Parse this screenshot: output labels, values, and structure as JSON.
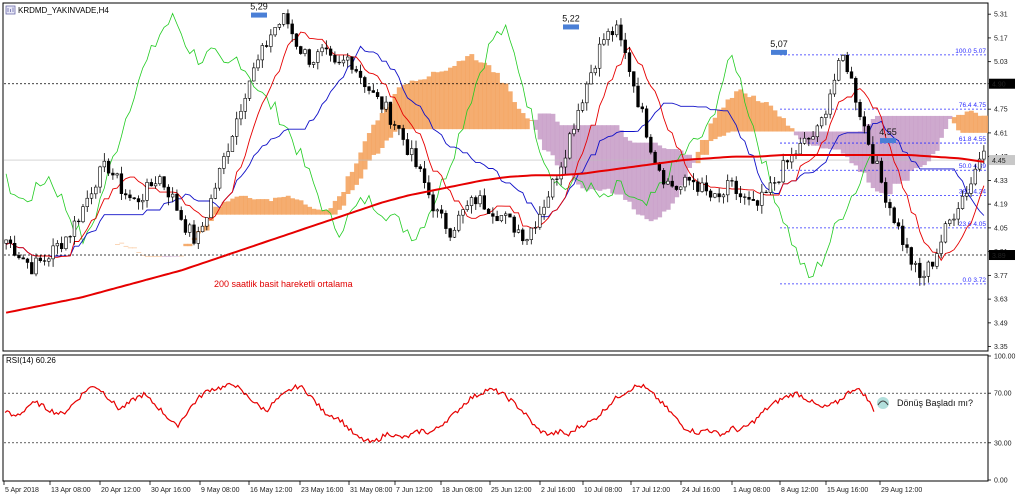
{
  "chart_data": [
    {
      "type": "candlestick",
      "title": "KRDMD_YAKINVADE,H4",
      "ylim": [
        3.33,
        5.37
      ],
      "y_ticks": [
        "5.31",
        "5.17",
        "5.03",
        "4.90",
        "4.75",
        "4.61",
        "4.47",
        "4.33",
        "4.19",
        "4.05",
        "3.91",
        "3.77",
        "3.63",
        "3.49",
        "3.35"
      ],
      "x_ticks": [
        "5 Apr 2018",
        "13 Apr 08:00",
        "20 Apr 12:00",
        "30 Apr 16:00",
        "9 May 08:00",
        "16 May 12:00",
        "23 May 16:00",
        "31 May 08:00",
        "7 Jun 12:00",
        "18 Jun 08:00",
        "25 Jun 12:00",
        "2 Jul 16:00",
        "10 Jul 08:00",
        "17 Jul 12:00",
        "24 Jul 16:00",
        "1 Aug 08:00",
        "8 Aug 12:00",
        "15 Aug 16:00",
        "29 Aug 12:00"
      ],
      "price_series": [
        3.98,
        3.9,
        3.82,
        3.86,
        3.94,
        4.02,
        4.16,
        4.33,
        4.42,
        4.29,
        4.2,
        4.26,
        4.36,
        4.24,
        4.08,
        3.96,
        4.18,
        4.42,
        4.66,
        4.9,
        5.05,
        5.22,
        5.29,
        5.12,
        5.04,
        5.08,
        4.98,
        5.06,
        4.94,
        4.82,
        4.74,
        4.62,
        4.46,
        4.3,
        4.12,
        4.04,
        4.14,
        4.22,
        4.18,
        4.12,
        4.06,
        4.0,
        4.14,
        4.3,
        4.5,
        4.74,
        4.96,
        5.16,
        5.22,
        5.02,
        4.74,
        4.48,
        4.32,
        4.28,
        4.34,
        4.26,
        4.2,
        4.3,
        4.22,
        4.16,
        4.26,
        4.38,
        4.48,
        4.56,
        4.62,
        4.88,
        5.07,
        4.8,
        4.54,
        4.3,
        4.1,
        3.9,
        3.74,
        3.86,
        4.04,
        4.2,
        4.32,
        4.55
      ],
      "ma200": [
        3.55,
        3.58,
        3.61,
        3.64,
        3.68,
        3.72,
        3.76,
        3.8,
        3.85,
        3.9,
        3.95,
        4.0,
        4.05,
        4.1,
        4.15,
        4.2,
        4.24,
        4.27,
        4.3,
        4.33,
        4.35,
        4.36,
        4.36,
        4.37,
        4.39,
        4.41,
        4.43,
        4.45,
        4.46,
        4.47,
        4.47,
        4.48,
        4.48,
        4.48,
        4.48,
        4.48,
        4.48,
        4.47,
        4.46,
        4.44
      ],
      "annotations": [
        {
          "label": "5,29",
          "value": 5.29
        },
        {
          "label": "5,22",
          "value": 5.22
        },
        {
          "label": "5,07",
          "value": 5.07
        },
        {
          "label": "4,55",
          "value": 4.55
        },
        {
          "label": "200 saatlik basit hareketli ortalama"
        }
      ],
      "horizontal_levels": [
        4.9,
        3.89
      ],
      "price_labels": [
        {
          "label": "4.90",
          "value": 4.9
        },
        {
          "label": "4.45",
          "value": 4.45
        },
        {
          "label": "3.89",
          "value": 3.89
        }
      ],
      "fibonacci": [
        {
          "label": "100.0 5.07",
          "value": 5.07
        },
        {
          "label": "76.4 4.75",
          "value": 4.75
        },
        {
          "label": "61.8 4.55",
          "value": 4.55
        },
        {
          "label": "50.0 4.39",
          "value": 4.39
        },
        {
          "label": "38.2 4.24",
          "value": 4.24
        },
        {
          "label": "23.6 4.05",
          "value": 4.05
        },
        {
          "label": "0.0 3.72",
          "value": 3.72
        }
      ]
    },
    {
      "type": "line",
      "title": "RSI(14) 60.26",
      "ylim": [
        0,
        100
      ],
      "y_ticks": [
        "100.00",
        "70.00",
        "30.00",
        "0.00"
      ],
      "levels": [
        70,
        30
      ],
      "series": [
        {
          "values": [
            56,
            51,
            54,
            61,
            62,
            58,
            55,
            53,
            59,
            66,
            73,
            76,
            71,
            64,
            57,
            61,
            66,
            69,
            63,
            57,
            50,
            43,
            52,
            61,
            68,
            73,
            74,
            75,
            78,
            71,
            66,
            60,
            56,
            63,
            68,
            73,
            76,
            71,
            63,
            55,
            52,
            49,
            42,
            35,
            32,
            30,
            34,
            38,
            35,
            34,
            37,
            40,
            38,
            42,
            48,
            53,
            60,
            66,
            69,
            73,
            72,
            69,
            64,
            58,
            51,
            42,
            38,
            37,
            39,
            36,
            42,
            45,
            48,
            54,
            61,
            67,
            71,
            75,
            76,
            71,
            65,
            58,
            51,
            43,
            40,
            38,
            41,
            38,
            37,
            42,
            40,
            44,
            49,
            56,
            61,
            65,
            68,
            70,
            66,
            62,
            58,
            60,
            63,
            69,
            74,
            71,
            61,
            50,
            43,
            39,
            40,
            34,
            30,
            27,
            33,
            40,
            46,
            53,
            58,
            57,
            60
          ]
        }
      ],
      "annotations": [
        {
          "label": "Dönüş Başladı mı?"
        }
      ]
    }
  ],
  "colors": {
    "candle": "#000000",
    "ma200": "#e60000",
    "tenkan": "#e60000",
    "kijun": "#1010c8",
    "chikou": "#22cc22",
    "cloud_up": "#f4a460",
    "cloud_down": "#c9a0c9",
    "fib": "#2b2bff",
    "rsi": "#e60000",
    "arrow": "#4a7fd6"
  }
}
